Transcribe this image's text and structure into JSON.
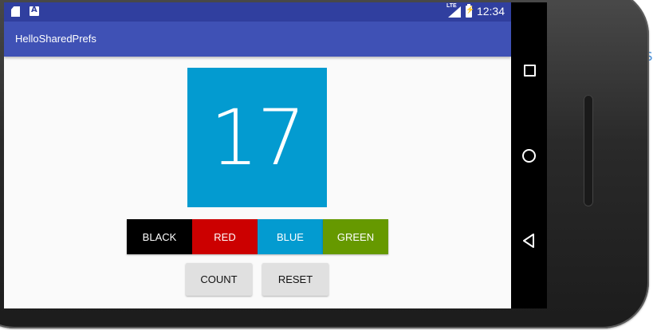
{
  "status_bar": {
    "icons": [
      "sd-card-icon",
      "notification-a-icon",
      "lte-signal-icon",
      "battery-charging-icon"
    ],
    "lte_label": "LTE",
    "time": "12:34"
  },
  "app_bar": {
    "title": "HelloSharedPrefs"
  },
  "main": {
    "count": "17",
    "count_background": "#039bd0",
    "color_buttons": [
      {
        "label": "BLACK",
        "color": "#000000"
      },
      {
        "label": "RED",
        "color": "#cc0000"
      },
      {
        "label": "BLUE",
        "color": "#039bd0"
      },
      {
        "label": "GREEN",
        "color": "#669900"
      }
    ],
    "count_button": "COUNT",
    "reset_button": "RESET"
  },
  "navigation_bar": {
    "icons": [
      "recents-square-icon",
      "home-circle-icon",
      "back-triangle-icon"
    ]
  },
  "edge_text": "S",
  "colors": {
    "status_bar": "#303f9f",
    "app_bar": "#3f51b5",
    "background": "#fafafa"
  }
}
